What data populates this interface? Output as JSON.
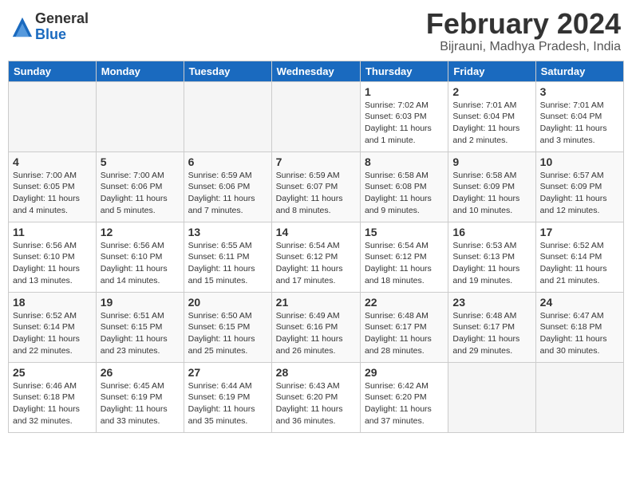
{
  "header": {
    "logo_general": "General",
    "logo_blue": "Blue",
    "title": "February 2024",
    "location": "Bijrauni, Madhya Pradesh, India"
  },
  "days_of_week": [
    "Sunday",
    "Monday",
    "Tuesday",
    "Wednesday",
    "Thursday",
    "Friday",
    "Saturday"
  ],
  "weeks": [
    [
      {
        "day": "",
        "info": ""
      },
      {
        "day": "",
        "info": ""
      },
      {
        "day": "",
        "info": ""
      },
      {
        "day": "",
        "info": ""
      },
      {
        "day": "1",
        "info": "Sunrise: 7:02 AM\nSunset: 6:03 PM\nDaylight: 11 hours and 1 minute."
      },
      {
        "day": "2",
        "info": "Sunrise: 7:01 AM\nSunset: 6:04 PM\nDaylight: 11 hours and 2 minutes."
      },
      {
        "day": "3",
        "info": "Sunrise: 7:01 AM\nSunset: 6:04 PM\nDaylight: 11 hours and 3 minutes."
      }
    ],
    [
      {
        "day": "4",
        "info": "Sunrise: 7:00 AM\nSunset: 6:05 PM\nDaylight: 11 hours and 4 minutes."
      },
      {
        "day": "5",
        "info": "Sunrise: 7:00 AM\nSunset: 6:06 PM\nDaylight: 11 hours and 5 minutes."
      },
      {
        "day": "6",
        "info": "Sunrise: 6:59 AM\nSunset: 6:06 PM\nDaylight: 11 hours and 7 minutes."
      },
      {
        "day": "7",
        "info": "Sunrise: 6:59 AM\nSunset: 6:07 PM\nDaylight: 11 hours and 8 minutes."
      },
      {
        "day": "8",
        "info": "Sunrise: 6:58 AM\nSunset: 6:08 PM\nDaylight: 11 hours and 9 minutes."
      },
      {
        "day": "9",
        "info": "Sunrise: 6:58 AM\nSunset: 6:09 PM\nDaylight: 11 hours and 10 minutes."
      },
      {
        "day": "10",
        "info": "Sunrise: 6:57 AM\nSunset: 6:09 PM\nDaylight: 11 hours and 12 minutes."
      }
    ],
    [
      {
        "day": "11",
        "info": "Sunrise: 6:56 AM\nSunset: 6:10 PM\nDaylight: 11 hours and 13 minutes."
      },
      {
        "day": "12",
        "info": "Sunrise: 6:56 AM\nSunset: 6:10 PM\nDaylight: 11 hours and 14 minutes."
      },
      {
        "day": "13",
        "info": "Sunrise: 6:55 AM\nSunset: 6:11 PM\nDaylight: 11 hours and 15 minutes."
      },
      {
        "day": "14",
        "info": "Sunrise: 6:54 AM\nSunset: 6:12 PM\nDaylight: 11 hours and 17 minutes."
      },
      {
        "day": "15",
        "info": "Sunrise: 6:54 AM\nSunset: 6:12 PM\nDaylight: 11 hours and 18 minutes."
      },
      {
        "day": "16",
        "info": "Sunrise: 6:53 AM\nSunset: 6:13 PM\nDaylight: 11 hours and 19 minutes."
      },
      {
        "day": "17",
        "info": "Sunrise: 6:52 AM\nSunset: 6:14 PM\nDaylight: 11 hours and 21 minutes."
      }
    ],
    [
      {
        "day": "18",
        "info": "Sunrise: 6:52 AM\nSunset: 6:14 PM\nDaylight: 11 hours and 22 minutes."
      },
      {
        "day": "19",
        "info": "Sunrise: 6:51 AM\nSunset: 6:15 PM\nDaylight: 11 hours and 23 minutes."
      },
      {
        "day": "20",
        "info": "Sunrise: 6:50 AM\nSunset: 6:15 PM\nDaylight: 11 hours and 25 minutes."
      },
      {
        "day": "21",
        "info": "Sunrise: 6:49 AM\nSunset: 6:16 PM\nDaylight: 11 hours and 26 minutes."
      },
      {
        "day": "22",
        "info": "Sunrise: 6:48 AM\nSunset: 6:17 PM\nDaylight: 11 hours and 28 minutes."
      },
      {
        "day": "23",
        "info": "Sunrise: 6:48 AM\nSunset: 6:17 PM\nDaylight: 11 hours and 29 minutes."
      },
      {
        "day": "24",
        "info": "Sunrise: 6:47 AM\nSunset: 6:18 PM\nDaylight: 11 hours and 30 minutes."
      }
    ],
    [
      {
        "day": "25",
        "info": "Sunrise: 6:46 AM\nSunset: 6:18 PM\nDaylight: 11 hours and 32 minutes."
      },
      {
        "day": "26",
        "info": "Sunrise: 6:45 AM\nSunset: 6:19 PM\nDaylight: 11 hours and 33 minutes."
      },
      {
        "day": "27",
        "info": "Sunrise: 6:44 AM\nSunset: 6:19 PM\nDaylight: 11 hours and 35 minutes."
      },
      {
        "day": "28",
        "info": "Sunrise: 6:43 AM\nSunset: 6:20 PM\nDaylight: 11 hours and 36 minutes."
      },
      {
        "day": "29",
        "info": "Sunrise: 6:42 AM\nSunset: 6:20 PM\nDaylight: 11 hours and 37 minutes."
      },
      {
        "day": "",
        "info": ""
      },
      {
        "day": "",
        "info": ""
      }
    ]
  ]
}
